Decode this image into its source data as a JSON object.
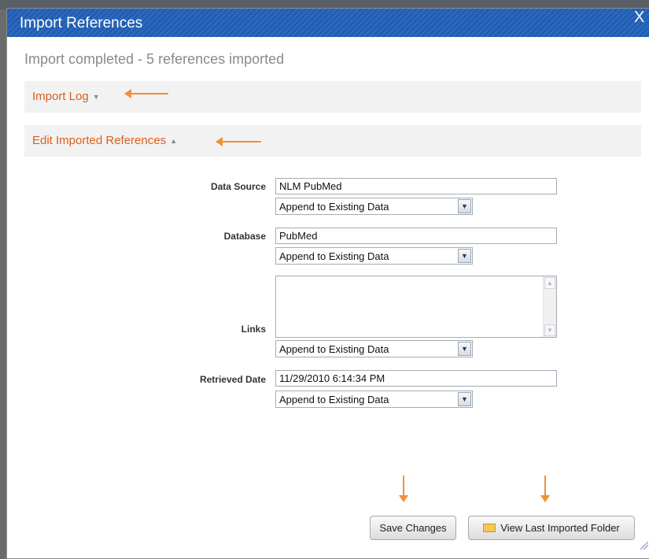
{
  "dialog": {
    "title": "Import References",
    "close": "X",
    "status": "Import completed - 5 references imported"
  },
  "sections": {
    "import_log": "Import Log",
    "edit_refs": "Edit Imported References"
  },
  "fields": {
    "data_source": {
      "label": "Data Source",
      "value": "NLM PubMed",
      "mode": "Append to Existing Data"
    },
    "database": {
      "label": "Database",
      "value": "PubMed",
      "mode": "Append to Existing Data"
    },
    "links": {
      "label": "Links",
      "value": "",
      "mode": "Append to Existing Data"
    },
    "retrieved_date": {
      "label": "Retrieved Date",
      "value": "11/29/2010 6:14:34 PM",
      "mode": "Append to Existing Data"
    }
  },
  "buttons": {
    "save": "Save Changes",
    "view_folder": "View Last Imported Folder"
  },
  "colors": {
    "titlebar": "#1f5eb4",
    "accent_link": "#d9601d",
    "annotation_arrow": "#f0903a"
  },
  "icons": {
    "section_collapsed": "caret-down-icon",
    "section_expanded": "caret-up-icon",
    "dropdown": "chevron-down-icon",
    "folder": "folder-icon"
  }
}
